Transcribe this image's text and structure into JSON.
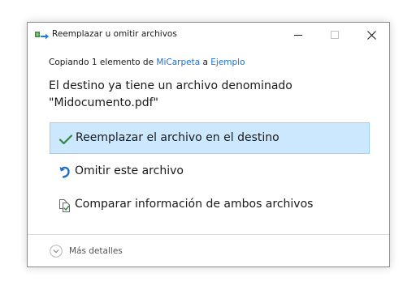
{
  "window": {
    "title": "Reemplazar u omitir archivos",
    "minimize_icon": "minimize-icon",
    "maximize_icon": "maximize-icon",
    "close_icon": "close-icon"
  },
  "copy_status": {
    "prefix": "Copiando 1 elemento de ",
    "source": "MiCarpeta",
    "connector": " a ",
    "destination": "Ejemplo"
  },
  "message": {
    "line1": "El destino ya tiene un archivo denominado",
    "line2": "\"Midocumento.pdf\""
  },
  "options": [
    {
      "label": "Reemplazar el archivo en el destino",
      "icon": "checkmark-icon",
      "selected": true
    },
    {
      "label": "Omitir este archivo",
      "icon": "skip-arrow-icon",
      "selected": false
    },
    {
      "label": "Comparar información de ambos archivos",
      "icon": "compare-files-icon",
      "selected": false
    }
  ],
  "footer": {
    "details_label": "Más detalles",
    "details_icon": "chevron-down-icon"
  },
  "colors": {
    "accent": "#1f6fc5",
    "selected_bg": "#cce8ff",
    "selected_border": "#99d1ff",
    "check": "#2e8b3d"
  }
}
